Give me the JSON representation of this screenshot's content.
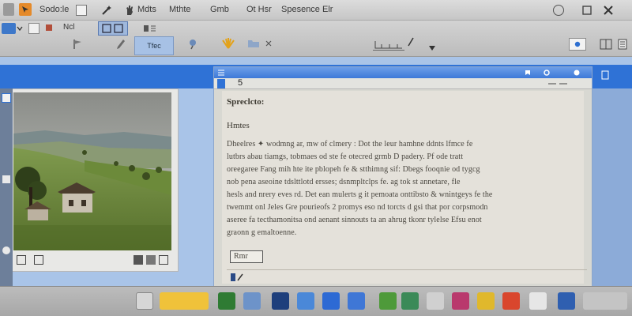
{
  "menubar": {
    "items": [
      "Sodo:le",
      "Mdts",
      "Mthte",
      "Gmb",
      "Ot Hsr",
      "Spesence Elr"
    ]
  },
  "toolbar": {
    "field_label": "Ncl",
    "tag_label": "Tfec"
  },
  "document": {
    "page_number": "5",
    "heading": "Spreclcto:",
    "subheading": "Hmtes",
    "paragraph_lines": [
      "Dheelres ✦ wodmng ar, mw of clmery : Dot the leur hamhne ddnts lfmce fe",
      "lutbrs abau tiamgs, tobmaes od ste fe otecred grmb D padery. Pf ode tratt",
      "oreegaree Fang mih hte ite pblopeh fe & stthimng sif: Dbegs fooqnie od tygcg",
      "nob pena aseoine tdslttlotd ersses; dsnmpltclps fe. ag tok st annetare, fle",
      "hesls and nrery eves rd. Det ean mulerts g it pemoata onttibsto & wnintgeys fe the",
      "twemmt onl Jeles Gre pourieofs 2 promys eso nd torcts d gsi that por corpsmodn",
      "aseree fa tecthamonitsa ond aenant sinnouts ta an ahrug tkonr tylelse Efsu enot",
      "graonn g emaltoenne."
    ],
    "field_value": "Rmr"
  }
}
